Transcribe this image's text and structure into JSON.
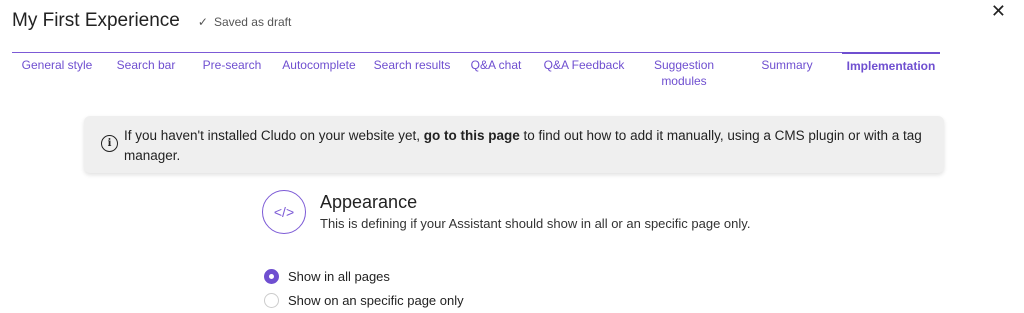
{
  "header": {
    "title": "My First Experience",
    "saved_icon": "check-icon",
    "saved_text": "Saved as draft",
    "close_icon": "close-icon"
  },
  "tabs": [
    {
      "label": "General style"
    },
    {
      "label": "Search bar"
    },
    {
      "label": "Pre-search"
    },
    {
      "label": "Autocomplete"
    },
    {
      "label": "Search results"
    },
    {
      "label": "Q&A chat"
    },
    {
      "label": "Q&A Feedback"
    },
    {
      "label": "Suggestion modules"
    },
    {
      "label": "Summary"
    },
    {
      "label": "Implementation",
      "active": true
    }
  ],
  "info": {
    "icon": "info-icon",
    "text_before": "If you haven't installed Cludo on your website yet, ",
    "link": "go to this page",
    "text_after": " to find out how to add it manually, using a CMS plugin or with a tag manager."
  },
  "appearance": {
    "icon": "code-icon",
    "title": "Appearance",
    "subtitle": "This is defining if your Assistant should show in all or an specific page only."
  },
  "options": [
    {
      "label": "Show in all pages",
      "selected": true
    },
    {
      "label": "Show on an specific page only",
      "selected": false
    }
  ],
  "colors": {
    "accent": "#6f4fd0",
    "info_bg": "#efefef"
  }
}
